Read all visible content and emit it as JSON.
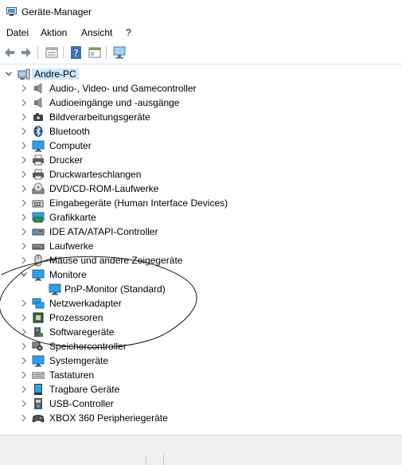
{
  "window": {
    "title": "Geräte-Manager"
  },
  "menu": [
    "Datei",
    "Aktion",
    "Ansicht",
    "?"
  ],
  "toolbar": [
    "back-icon",
    "forward-icon",
    "properties-icon",
    "help-icon",
    "view-icon",
    "monitor-scan-icon"
  ],
  "tree": {
    "root": "Andre-PC",
    "items": [
      {
        "label": "Audio-, Video- und Gamecontroller",
        "icon": "speaker-icon"
      },
      {
        "label": "Audioeingänge und -ausgänge",
        "icon": "speaker-icon"
      },
      {
        "label": "Bildverarbeitungsgeräte",
        "icon": "camera-icon"
      },
      {
        "label": "Bluetooth",
        "icon": "bluetooth-icon"
      },
      {
        "label": "Computer",
        "icon": "computer-icon"
      },
      {
        "label": "Drucker",
        "icon": "printer-icon"
      },
      {
        "label": "Druckwarteschlangen",
        "icon": "printer-icon"
      },
      {
        "label": "DVD/CD-ROM-Laufwerke",
        "icon": "disc-icon"
      },
      {
        "label": "Eingabegeräte (Human Interface Devices)",
        "icon": "hid-icon"
      },
      {
        "label": "Grafikkarte",
        "icon": "display-adapter-icon"
      },
      {
        "label": "IDE ATA/ATAPI-Controller",
        "icon": "ide-icon"
      },
      {
        "label": "Laufwerke",
        "icon": "drive-icon"
      },
      {
        "label": "Mäuse und andere Zeigegeräte",
        "icon": "mouse-icon"
      },
      {
        "label": "Monitore",
        "icon": "monitor-icon",
        "expanded": true
      },
      {
        "label": "PnP-Monitor (Standard)",
        "icon": "monitor-icon",
        "child": true
      },
      {
        "label": "Netzwerkadapter",
        "icon": "network-icon"
      },
      {
        "label": "Prozessoren",
        "icon": "processor-icon"
      },
      {
        "label": "Softwaregeräte",
        "icon": "software-icon"
      },
      {
        "label": "Speichercontroller",
        "icon": "storage-icon"
      },
      {
        "label": "Systemgeräte",
        "icon": "system-icon"
      },
      {
        "label": "Tastaturen",
        "icon": "keyboard-icon"
      },
      {
        "label": "Tragbare Geräte",
        "icon": "portable-icon"
      },
      {
        "label": "USB-Controller",
        "icon": "usb-icon"
      },
      {
        "label": "XBOX 360 Peripheriegeräte",
        "icon": "gamepad-icon"
      }
    ]
  },
  "colors": {
    "selection": "#cce8ff",
    "chevron": "#7a7a7a"
  }
}
